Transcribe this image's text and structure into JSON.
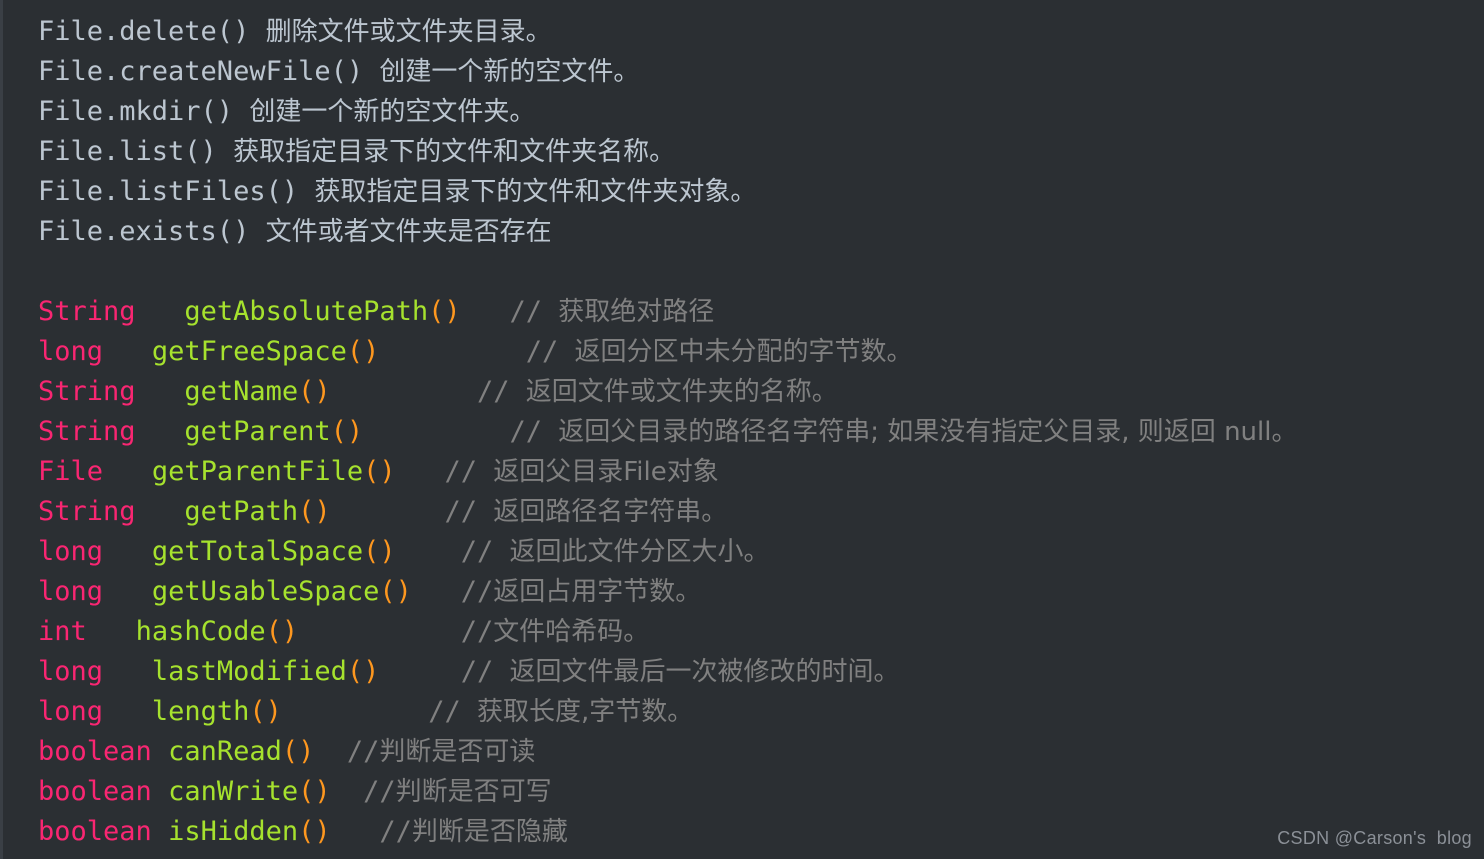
{
  "theme": {
    "background": "#2b2f33",
    "plain_text": "#bcc6d0",
    "type_pink": "#f92672",
    "method_green": "#a6e22e",
    "paren_orange": "#fd971f",
    "comment_gray": "#808080",
    "watermark_gray": "#8b9097"
  },
  "static_methods": [
    {
      "call": "File.delete()",
      "gap": " ",
      "desc": "删除文件或文件夹目录。"
    },
    {
      "call": "File.createNewFile()",
      "gap": " ",
      "desc": "创建一个新的空文件。"
    },
    {
      "call": "File.mkdir()",
      "gap": " ",
      "desc": "创建一个新的空文件夹。"
    },
    {
      "call": "File.list()",
      "gap": " ",
      "desc": "获取指定目录下的文件和文件夹名称。"
    },
    {
      "call": "File.listFiles()",
      "gap": " ",
      "desc": "获取指定目录下的文件和文件夹对象。"
    },
    {
      "call": "File.exists()",
      "gap": " ",
      "desc": "文件或者文件夹是否存在"
    }
  ],
  "instance_methods": [
    {
      "ret": "String",
      "pad1": "   ",
      "name": "getAbsolutePath",
      "paren": "()",
      "pad2": "   ",
      "comment": "// 获取绝对路径"
    },
    {
      "ret": "long",
      "pad1": "   ",
      "name": "getFreeSpace",
      "paren": "()",
      "pad2": "         ",
      "comment": "// 返回分区中未分配的字节数。"
    },
    {
      "ret": "String",
      "pad1": "   ",
      "name": "getName",
      "paren": "()",
      "pad2": "         ",
      "comment": "// 返回文件或文件夹的名称。"
    },
    {
      "ret": "String",
      "pad1": "   ",
      "name": "getParent",
      "paren": "()",
      "pad2": "         ",
      "comment": "// 返回父目录的路径名字符串; 如果没有指定父目录, 则返回 null。"
    },
    {
      "ret": "File",
      "pad1": "   ",
      "name": "getParentFile",
      "paren": "()",
      "pad2": "   ",
      "comment": "// 返回父目录File对象"
    },
    {
      "ret": "String",
      "pad1": "   ",
      "name": "getPath",
      "paren": "()",
      "pad2": "       ",
      "comment": "// 返回路径名字符串。"
    },
    {
      "ret": "long",
      "pad1": "   ",
      "name": "getTotalSpace",
      "paren": "()",
      "pad2": "    ",
      "comment": "// 返回此文件分区大小。"
    },
    {
      "ret": "long",
      "pad1": "   ",
      "name": "getUsableSpace",
      "paren": "()",
      "pad2": "   ",
      "comment": "//返回占用字节数。"
    },
    {
      "ret": "int",
      "pad1": "   ",
      "name": "hashCode",
      "paren": "()",
      "pad2": "          ",
      "comment": "//文件哈希码。"
    },
    {
      "ret": "long",
      "pad1": "   ",
      "name": "lastModified",
      "paren": "()",
      "pad2": "     ",
      "comment": "// 返回文件最后一次被修改的时间。"
    },
    {
      "ret": "long",
      "pad1": "   ",
      "name": "length",
      "paren": "()",
      "pad2": "         ",
      "comment": "// 获取长度,字节数。"
    },
    {
      "ret": "boolean",
      "pad1": " ",
      "name": "canRead",
      "paren": "()",
      "pad2": "  ",
      "comment": "//判断是否可读"
    },
    {
      "ret": "boolean",
      "pad1": " ",
      "name": "canWrite",
      "paren": "()",
      "pad2": "  ",
      "comment": "//判断是否可写"
    },
    {
      "ret": "boolean",
      "pad1": " ",
      "name": "isHidden",
      "paren": "()",
      "pad2": "   ",
      "comment": "//判断是否隐藏"
    }
  ],
  "watermark": {
    "text": "CSDN @Carson's  blog"
  }
}
